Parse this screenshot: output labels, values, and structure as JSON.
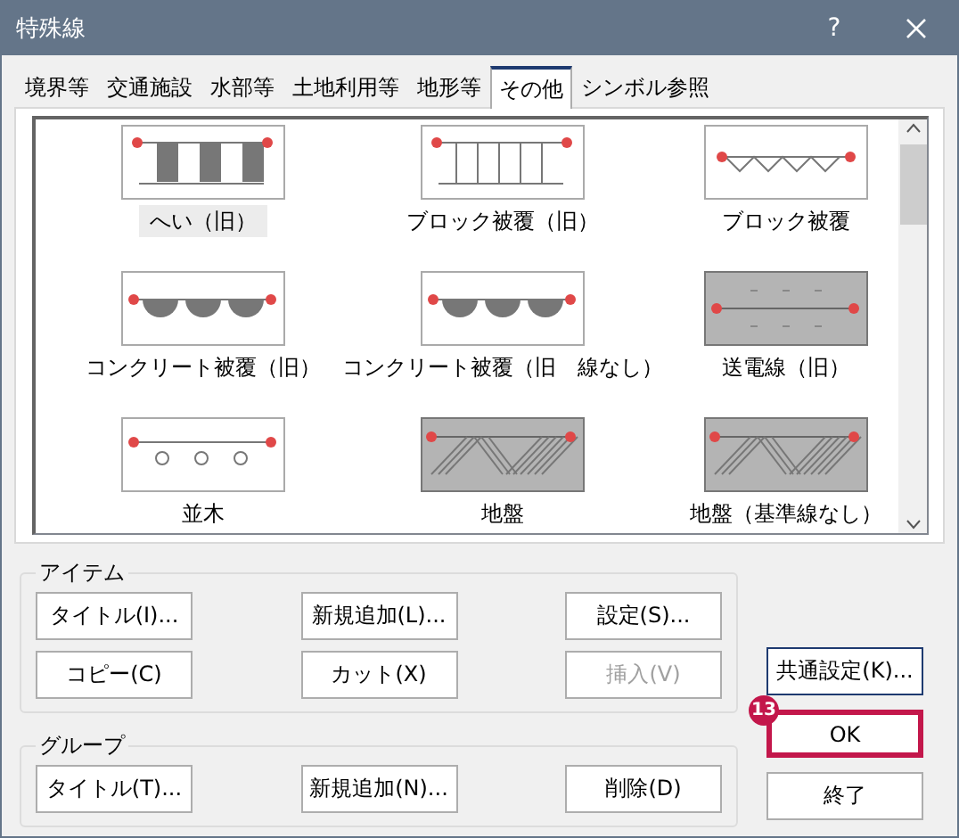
{
  "window": {
    "title": "特殊線",
    "help_button": "?"
  },
  "tabs": [
    {
      "label": "境界等",
      "selected": false
    },
    {
      "label": "交通施設",
      "selected": false
    },
    {
      "label": "水部等",
      "selected": false
    },
    {
      "label": "土地利用等",
      "selected": false
    },
    {
      "label": "地形等",
      "selected": false
    },
    {
      "label": "その他",
      "selected": true
    },
    {
      "label": "シンボル参照",
      "selected": false
    }
  ],
  "symbols": [
    {
      "label": "へい（旧）",
      "kind": "fence",
      "selected": true
    },
    {
      "label": "ブロック被覆（旧）",
      "kind": "ladder",
      "selected": false
    },
    {
      "label": "ブロック被覆",
      "kind": "zigzag",
      "selected": false
    },
    {
      "label": "コンクリート被覆（旧）",
      "kind": "halfmoon",
      "selected": false
    },
    {
      "label": "コンクリート被覆（旧　線なし）",
      "kind": "halfmoon",
      "selected": false
    },
    {
      "label": "送電線（旧）",
      "kind": "powerline",
      "selected": false
    },
    {
      "label": "並木",
      "kind": "circles",
      "selected": false
    },
    {
      "label": "地盤",
      "kind": "hatch",
      "selected": false
    },
    {
      "label": "地盤（基準線なし）",
      "kind": "hatch",
      "selected": false
    }
  ],
  "item_group": {
    "title": "アイテム",
    "buttons": [
      {
        "label": "タイトル(I)...",
        "disabled": false
      },
      {
        "label": "新規追加(L)...",
        "disabled": false
      },
      {
        "label": "設定(S)...",
        "disabled": false
      },
      {
        "label": "コピー(C)",
        "disabled": false
      },
      {
        "label": "カット(X)",
        "disabled": false
      },
      {
        "label": "挿入(V)",
        "disabled": true
      }
    ]
  },
  "group_group": {
    "title": "グループ",
    "buttons": [
      {
        "label": "タイトル(T)...",
        "disabled": false
      },
      {
        "label": "新規追加(N)...",
        "disabled": false
      },
      {
        "label": "削除(D)",
        "disabled": false
      }
    ]
  },
  "side_buttons": [
    {
      "label": "共通設定(K)...",
      "kind": "default"
    },
    {
      "label": "OK",
      "kind": "highlighted",
      "badge": "13"
    },
    {
      "label": "終了",
      "kind": "normal"
    }
  ]
}
